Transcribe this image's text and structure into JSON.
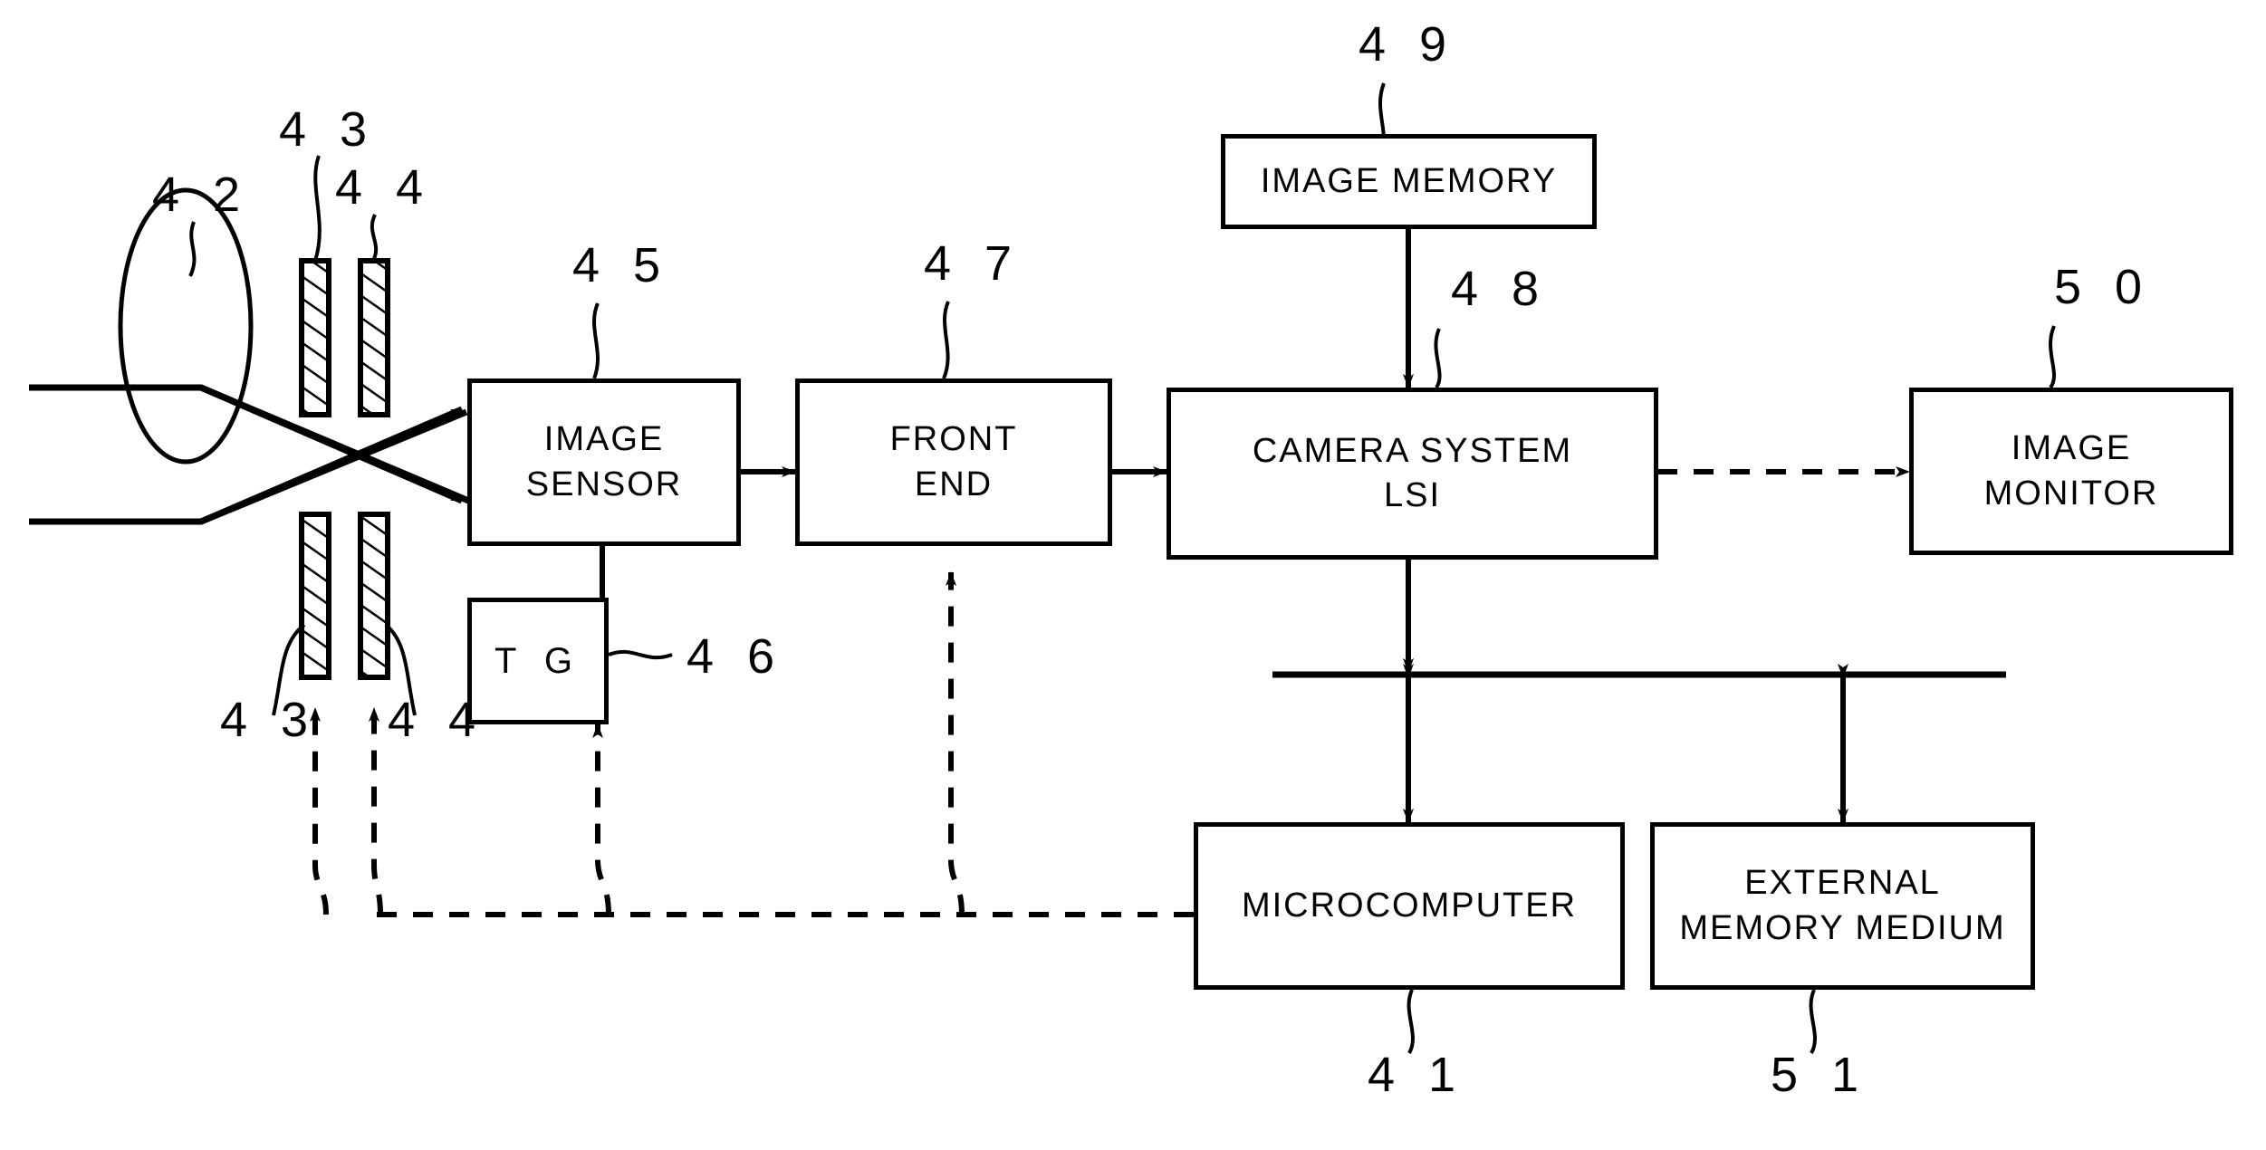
{
  "figure": {
    "kind": "patent-block-diagram",
    "line_color": "#000000",
    "background_color": "#ffffff"
  },
  "blocks": [
    {
      "id": "image_memory",
      "lines": [
        "IMAGE MEMORY"
      ],
      "ref": "4 9"
    },
    {
      "id": "camera_system",
      "lines": [
        "CAMERA SYSTEM",
        "LSI"
      ],
      "ref": "4 8"
    },
    {
      "id": "image_monitor",
      "lines": [
        "IMAGE",
        "MONITOR"
      ],
      "ref": "5 0"
    },
    {
      "id": "image_sensor",
      "lines": [
        "IMAGE",
        "SENSOR"
      ],
      "ref": "4 5"
    },
    {
      "id": "front_end",
      "lines": [
        "FRONT",
        "END"
      ],
      "ref": "4 7"
    },
    {
      "id": "tg",
      "lines": [
        "T G"
      ],
      "ref": "4 6"
    },
    {
      "id": "microcomputer",
      "lines": [
        "MICROCOMPUTER"
      ],
      "ref": "4 1"
    },
    {
      "id": "external_memory",
      "lines": [
        "EXTERNAL",
        "MEMORY MEDIUM"
      ],
      "ref": "5 1"
    }
  ],
  "optics": {
    "lens_ref": "4 2",
    "filter1_ref_top": "4 3",
    "filter2_ref_top": "4 4",
    "filter1_ref_bottom": "4 3",
    "filter2_ref_bottom": "4 4"
  },
  "labels": {
    "image_memory": "IMAGE MEMORY",
    "camera_system_1": "CAMERA SYSTEM",
    "camera_system_2": "LSI",
    "image_monitor_1": "IMAGE",
    "image_monitor_2": "MONITOR",
    "image_sensor_1": "IMAGE",
    "image_sensor_2": "SENSOR",
    "front_end_1": "FRONT",
    "front_end_2": "END",
    "tg": "T G",
    "microcomputer": "MICROCOMPUTER",
    "external_memory_1": "EXTERNAL",
    "external_memory_2": "MEMORY MEDIUM"
  },
  "refs": {
    "lens": "4 2",
    "filter43_top": "4 3",
    "filter44_top": "4 4",
    "filter43_bottom": "4 3",
    "filter44_bottom": "4 4",
    "image_sensor": "4 5",
    "tg": "4 6",
    "front_end": "4 7",
    "camera_system": "4 8",
    "image_memory": "4 9",
    "image_monitor": "5 0",
    "microcomputer": "4 1",
    "external_memory": "5 1"
  }
}
